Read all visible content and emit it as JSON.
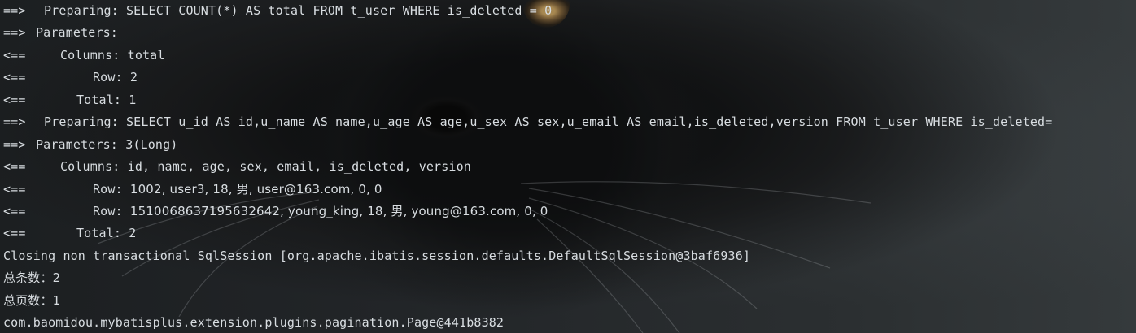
{
  "console": {
    "lines": [
      {
        "kind": "out",
        "arrow": "==>",
        "label": "Preparing:",
        "text": "SELECT COUNT(*) AS total FROM t_user WHERE is_deleted = 0"
      },
      {
        "kind": "out",
        "arrow": "==>",
        "label": "Parameters:",
        "text": ""
      },
      {
        "kind": "in",
        "arrow": "<==",
        "label": "Columns:",
        "text": "total"
      },
      {
        "kind": "in",
        "arrow": "<==",
        "label": "Row:",
        "text": "2"
      },
      {
        "kind": "in",
        "arrow": "<==",
        "label": "Total:",
        "text": "1"
      },
      {
        "kind": "out",
        "arrow": "==>",
        "label": "Preparing:",
        "text": "SELECT u_id AS id,u_name AS name,u_age AS age,u_sex AS sex,u_email AS email,is_deleted,version FROM t_user WHERE is_deleted="
      },
      {
        "kind": "out",
        "arrow": "==>",
        "label": "Parameters:",
        "text": "3(Long)"
      },
      {
        "kind": "in",
        "arrow": "<==",
        "label": "Columns:",
        "text": "id, name, age, sex, email, is_deleted, version"
      },
      {
        "kind": "in",
        "arrow": "<==",
        "label": "Row:",
        "text": "1002, user3, 18, 男, user@163.com, 0, 0"
      },
      {
        "kind": "in",
        "arrow": "<==",
        "label": "Row:",
        "text": "1510068637195632642, young_king, 18, 男, young@163.com, 0, 0"
      },
      {
        "kind": "in",
        "arrow": "<==",
        "label": "Total:",
        "text": "2"
      },
      {
        "kind": "plain",
        "text": "Closing non transactional SqlSession [org.apache.ibatis.session.defaults.DefaultSqlSession@3baf6936]"
      },
      {
        "kind": "plain",
        "text": "总条数：2"
      },
      {
        "kind": "plain",
        "text": "总页数：1"
      },
      {
        "kind": "plain",
        "text": "com.baomidou.mybatisplus.extension.plugins.pagination.Page@441b8382"
      }
    ]
  }
}
